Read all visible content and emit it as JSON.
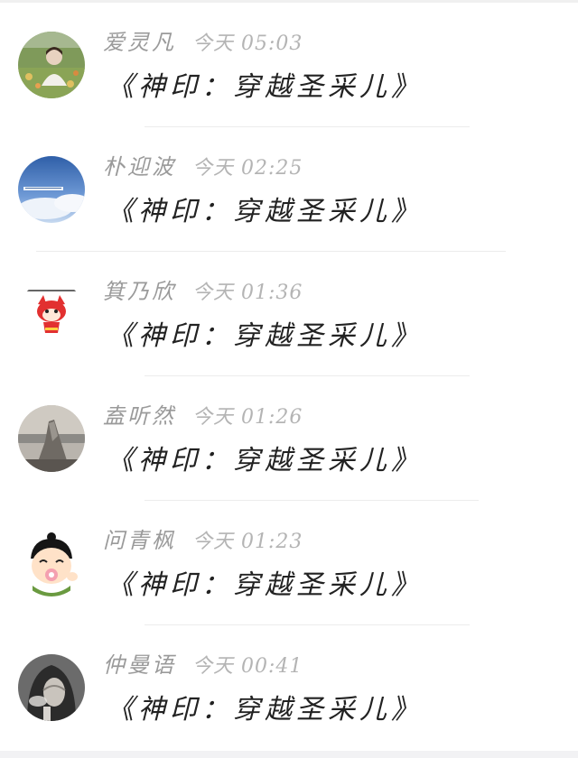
{
  "comments": [
    {
      "username": "爱灵凡",
      "date": "今天",
      "time": "05:03",
      "content": "《神印：穿越圣采儿》",
      "avatar_icon": "girl-in-flowers-photo"
    },
    {
      "username": "朴迎波",
      "date": "今天",
      "time": "02:25",
      "content": "《神印：穿越圣采儿》",
      "avatar_icon": "sky-clouds-photo"
    },
    {
      "username": "箕乃欣",
      "date": "今天",
      "time": "01:36",
      "content": "《神印：穿越圣采儿》",
      "avatar_icon": "red-fox-cartoon"
    },
    {
      "username": "盍听然",
      "date": "今天",
      "time": "01:26",
      "content": "《神印：穿越圣采儿》",
      "avatar_icon": "rock-sea-photo"
    },
    {
      "username": "问青枫",
      "date": "今天",
      "time": "01:23",
      "content": "《神印：穿越圣采儿》",
      "avatar_icon": "cartoon-boy-pacifier"
    },
    {
      "username": "仲曼语",
      "date": "今天",
      "time": "00:41",
      "content": "《神印：穿越圣采儿》",
      "avatar_icon": "hooded-figure-photo"
    }
  ],
  "colors": {
    "username": "#9a9a9a",
    "time": "#b4b4b4",
    "content": "#222222",
    "divider": "#ececec"
  }
}
